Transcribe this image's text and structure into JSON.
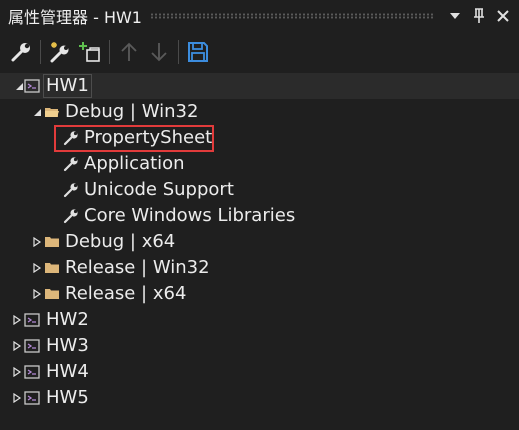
{
  "window": {
    "title": "属性管理器 - HW1"
  },
  "titlebar_buttons": [
    {
      "name": "dropdown-icon"
    },
    {
      "name": "pin-icon"
    },
    {
      "name": "close-icon"
    }
  ],
  "toolbar": {
    "buttons": [
      {
        "name": "properties-button",
        "icon": "wrench-icon",
        "enabled": true
      },
      {
        "name": "new-property-sheet-button",
        "icon": "wrench-sparkle-icon",
        "enabled": true
      },
      {
        "name": "add-existing-property-sheet-button",
        "icon": "add-sheet-icon",
        "enabled": true
      },
      {
        "name": "move-up-button",
        "icon": "arrow-up-icon",
        "enabled": false
      },
      {
        "name": "move-down-button",
        "icon": "arrow-down-icon",
        "enabled": false
      },
      {
        "name": "save-button",
        "icon": "save-icon",
        "enabled": true
      }
    ]
  },
  "tree": {
    "nodes": [
      {
        "id": "hw1",
        "label": "HW1",
        "type": "project",
        "level": 0,
        "expanded": true
      },
      {
        "id": "debug-win32",
        "label": "Debug | Win32",
        "type": "folder",
        "level": 1,
        "expanded": true
      },
      {
        "id": "propertysheet",
        "label": "PropertySheet",
        "type": "sheet",
        "level": 2
      },
      {
        "id": "application",
        "label": "Application",
        "type": "sheet",
        "level": 2
      },
      {
        "id": "unicode-support",
        "label": "Unicode Support",
        "type": "sheet",
        "level": 2
      },
      {
        "id": "core-windows-libraries",
        "label": "Core Windows Libraries",
        "type": "sheet",
        "level": 2
      },
      {
        "id": "debug-x64",
        "label": "Debug | x64",
        "type": "folder",
        "level": 1,
        "expanded": false
      },
      {
        "id": "release-win32",
        "label": "Release | Win32",
        "type": "folder",
        "level": 1,
        "expanded": false
      },
      {
        "id": "release-x64",
        "label": "Release | x64",
        "type": "folder",
        "level": 1,
        "expanded": false
      },
      {
        "id": "hw2",
        "label": "HW2",
        "type": "project",
        "level": 0,
        "expanded": false
      },
      {
        "id": "hw3",
        "label": "HW3",
        "type": "project",
        "level": 0,
        "expanded": false
      },
      {
        "id": "hw4",
        "label": "HW4",
        "type": "project",
        "level": 0,
        "expanded": false
      },
      {
        "id": "hw5",
        "label": "HW5",
        "type": "project",
        "level": 0,
        "expanded": false
      }
    ],
    "selected": "hw1",
    "highlighted": "propertysheet"
  },
  "colors": {
    "background": "#1f1f1f",
    "text": "#ececec",
    "highlight_border": "#e23b3b",
    "save_icon": "#3c8dde",
    "folder_icon": "#dcb67a",
    "disabled_icon": "#5a5a5a"
  }
}
